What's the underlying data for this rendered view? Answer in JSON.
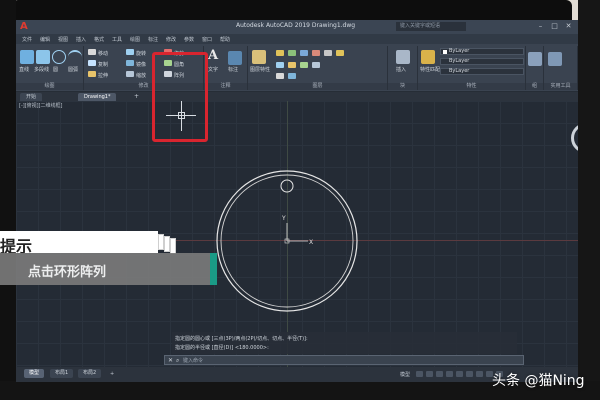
{
  "titlebar": {
    "app_logo": "A",
    "title": "Autodesk AutoCAD 2019   Drawing1.dwg",
    "search_placeholder": "键入关键字或短语",
    "min": "–",
    "max": "□",
    "close": "✕"
  },
  "menubar": {
    "items": [
      "文件",
      "编辑",
      "视图",
      "插入",
      "格式",
      "工具",
      "绘图",
      "标注",
      "修改",
      "参数",
      "窗口",
      "帮助"
    ]
  },
  "ribbon": {
    "groups": [
      {
        "label": "绘图"
      },
      {
        "label": "修改"
      },
      {
        "label": "注释"
      },
      {
        "label": "图层"
      },
      {
        "label": "块"
      },
      {
        "label": "特性"
      },
      {
        "label": "组"
      },
      {
        "label": "实用工具"
      },
      {
        "label": "剪贴板"
      }
    ],
    "draw_buttons": [
      "直线",
      "多段线",
      "圆",
      "圆弧"
    ],
    "modify_buttons": [
      "移动",
      "旋转",
      "修剪",
      "复制",
      "镜像",
      "圆角",
      "拉伸",
      "缩放",
      "阵列"
    ],
    "annotation_buttons": [
      "文字",
      "标注"
    ],
    "layer_buttons": [
      "图层特性"
    ],
    "block_buttons": [
      "插入"
    ],
    "properties": {
      "color": "ByLayer",
      "linetype": "ByLayer",
      "lineweight": "ByLayer"
    },
    "properties_button": "特性匹配"
  },
  "tabs": {
    "start": "开始",
    "drawing": "Drawing1*",
    "add": "+"
  },
  "canvas": {
    "view_label": "[-][俯视][二维线框]",
    "ucs_y": "Y",
    "ucs_x": "X"
  },
  "command": {
    "history": [
      "指定圆的圆心或 [三点(3P)/两点(2P)/切点、切点、半径(T)]:",
      "指定圆的半径或 [直径(D)] <180.0000>:"
    ],
    "input_placeholder": "键入命令",
    "icons": [
      "close-icon",
      "search-icon"
    ]
  },
  "statusbar": {
    "layout_tabs": [
      "模型",
      "布局1",
      "布局2"
    ],
    "add": "+",
    "mode": "模型"
  },
  "tip": {
    "header": "提示",
    "body": "点击环形阵列"
  },
  "watermark": "头条 @猫Ning",
  "colors": {
    "highlight": "#d9252f",
    "accent": "#1a9a86",
    "canvas": "#242b35"
  }
}
